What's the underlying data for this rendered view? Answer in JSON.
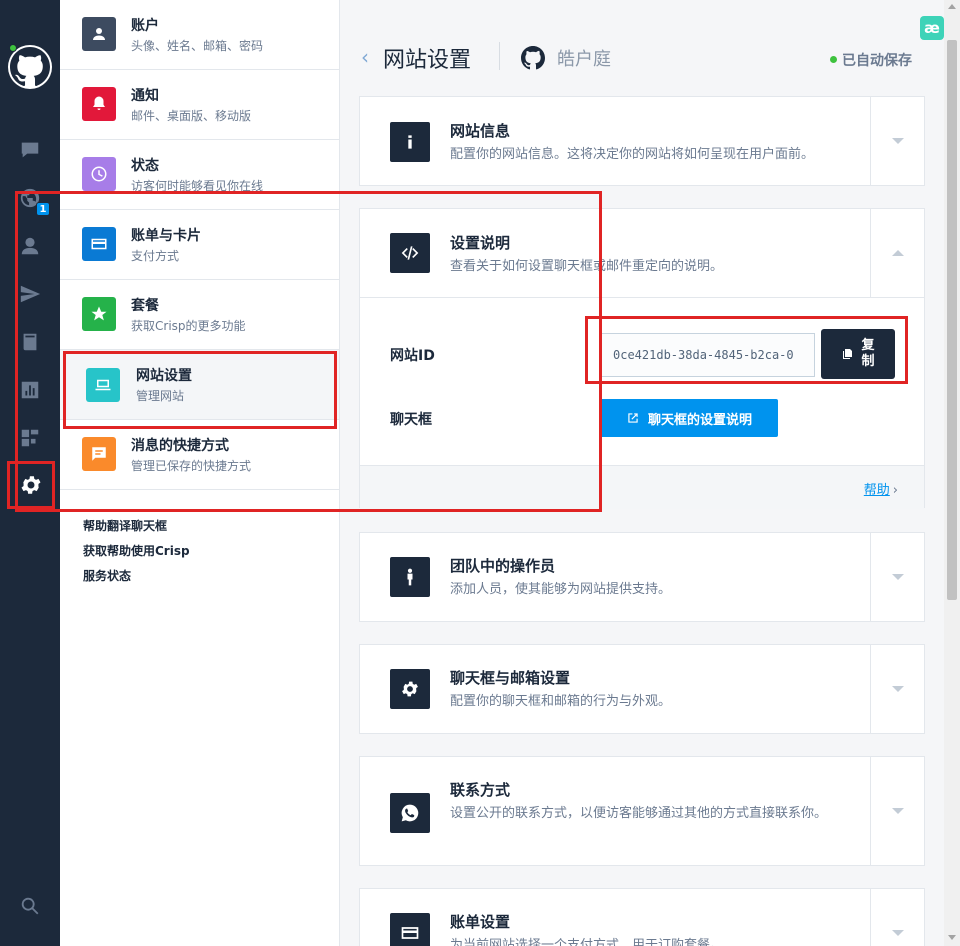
{
  "rail": {
    "items": [
      {
        "icon": "chat-icon"
      },
      {
        "icon": "globe-icon",
        "badge": "1"
      },
      {
        "icon": "user-icon"
      },
      {
        "icon": "send-icon"
      },
      {
        "icon": "book-icon"
      },
      {
        "icon": "analytics-icon"
      },
      {
        "icon": "plugins-icon"
      },
      {
        "icon": "settings-icon"
      },
      {
        "icon": "search-icon"
      }
    ]
  },
  "menu": {
    "items": [
      {
        "title": "账户",
        "subtitle": "头像、姓名、邮箱、密码",
        "icon": "account-icon",
        "color": "#3d4b60"
      },
      {
        "title": "通知",
        "subtitle": "邮件、桌面版、移动版",
        "icon": "bell-icon",
        "color": "#e2183a"
      },
      {
        "title": "状态",
        "subtitle": "访客何时能够看见你在线",
        "icon": "clock-icon",
        "color": "#a77de8"
      },
      {
        "title": "账单与卡片",
        "subtitle": "支付方式",
        "icon": "card-icon",
        "color": "#0a7ad4"
      },
      {
        "title": "套餐",
        "subtitle": "获取Crisp的更多功能",
        "icon": "star-icon",
        "color": "#25b24a"
      },
      {
        "title": "网站设置",
        "subtitle": "管理网站",
        "icon": "laptop-icon",
        "color": "#27c4c9"
      },
      {
        "title": "消息的快捷方式",
        "subtitle": "管理已保存的快捷方式",
        "icon": "shortcut-icon",
        "color": "#fa8a2b"
      }
    ],
    "links": [
      "帮助翻译聊天框",
      "获取帮助使用Crisp",
      "服务状态"
    ]
  },
  "header": {
    "title": "网站设置",
    "site_name": "皓户庭",
    "autosave": "已自动保存",
    "ext_badge": "æ"
  },
  "cards": {
    "info": {
      "title": "网站信息",
      "subtitle": "配置你的网站信息。这将决定你的网站将如何呈现在用户面前。"
    },
    "setup": {
      "title": "设置说明",
      "subtitle": "查看关于如何设置聊天框或邮件重定向的说明。",
      "website_id_label": "网站ID",
      "website_id_value": "0ce421db-38da-4845-b2ca-0",
      "copy_label": "复制",
      "chatbox_label": "聊天框",
      "chatbox_button": "聊天框的设置说明",
      "help_link": "帮助"
    },
    "operators": {
      "title": "团队中的操作员",
      "subtitle": "添加人员，使其能够为网站提供支持。"
    },
    "chatbox": {
      "title": "聊天框与邮箱设置",
      "subtitle": "配置你的聊天框和邮箱的行为与外观。"
    },
    "contact": {
      "title": "联系方式",
      "subtitle": "设置公开的联系方式，以便访客能够通过其他的方式直接联系你。"
    },
    "billing": {
      "title": "账单设置",
      "subtitle": "为当前网站选择一个支付方式，用于订购套餐。"
    }
  }
}
